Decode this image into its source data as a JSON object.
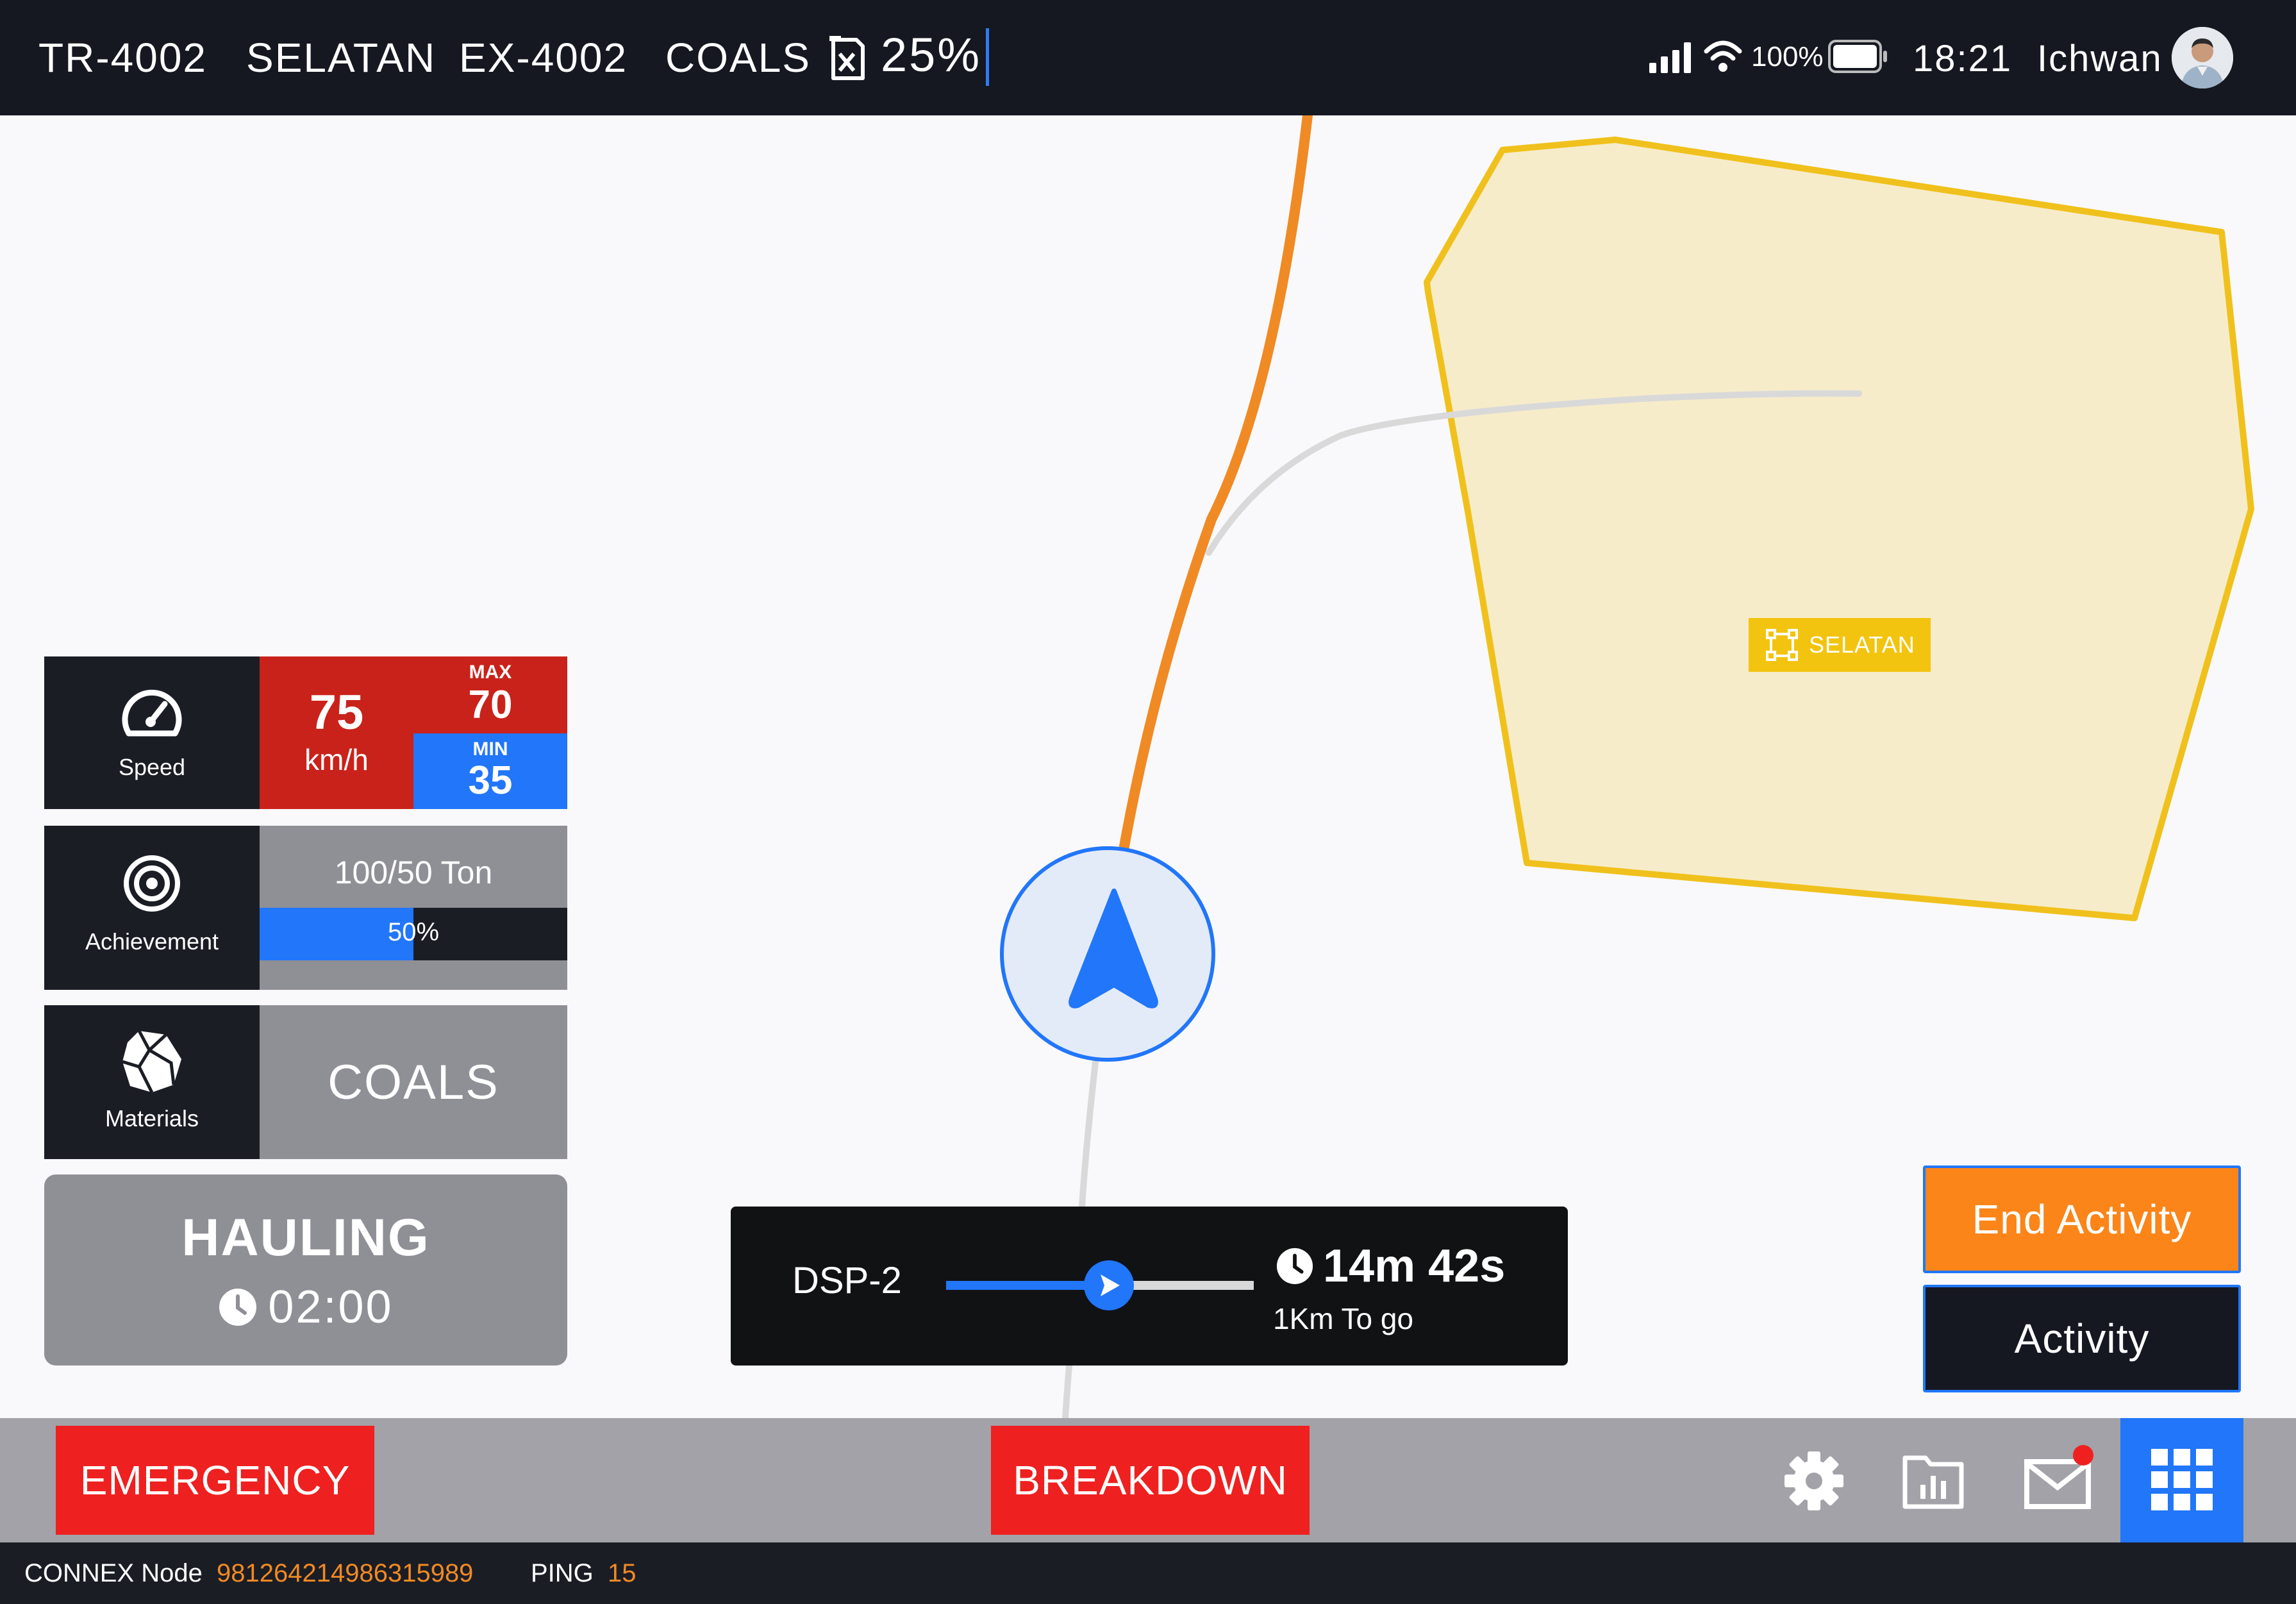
{
  "topbar": {
    "truck_id": "TR-4002",
    "area": "SELATAN",
    "excavator_id": "EX-4002",
    "material": "COALS",
    "fuel_icon": "fuel-can-icon",
    "fuel_level": "25%",
    "signal_icon": "cell-signal-icon",
    "wifi_icon": "wifi-icon",
    "battery_percent": "100%",
    "battery_icon": "battery-icon",
    "time": "18:21",
    "user_name": "Ichwan"
  },
  "map": {
    "zone_name": "SELATAN",
    "zone_icon": "polygon-select-icon",
    "colors": {
      "route_active": "#f08a24",
      "route_inactive": "#d9d9d9",
      "zone_fill": "#f7ecca",
      "zone_border": "#f0c11c",
      "marker": "#2176fa"
    }
  },
  "speed": {
    "icon": "speedometer-icon",
    "label": "Speed",
    "current": "75",
    "unit": "km/h",
    "max_label": "MAX",
    "max": "70",
    "min_label": "MIN",
    "min": "35"
  },
  "achievement": {
    "icon": "target-icon",
    "label": "Achievement",
    "tonnage": "100/50 Ton",
    "progress_text": "50%",
    "progress": 0.5
  },
  "materials": {
    "icon": "rock-icon",
    "label": "Materials",
    "value": "COALS"
  },
  "activity_status": {
    "status": "HAULING",
    "clock_icon": "clock-icon",
    "timer": "02:00"
  },
  "route": {
    "destination": "DSP-2",
    "progress": 0.53,
    "eta": "14m 42s",
    "distance": "1Km To go"
  },
  "buttons": {
    "end_activity": "End Activity",
    "activity": "Activity",
    "emergency": "EMERGENCY",
    "breakdown": "BREAKDOWN"
  },
  "toolbar": {
    "settings_icon": "gear-icon",
    "reports_icon": "folder-chart-icon",
    "mail_icon": "mail-icon",
    "apps_icon": "grid-menu-icon"
  },
  "status": {
    "node_label": "CONNEX Node",
    "node_id": "981264214986315989",
    "ping_label": "PING",
    "ping": "15"
  }
}
